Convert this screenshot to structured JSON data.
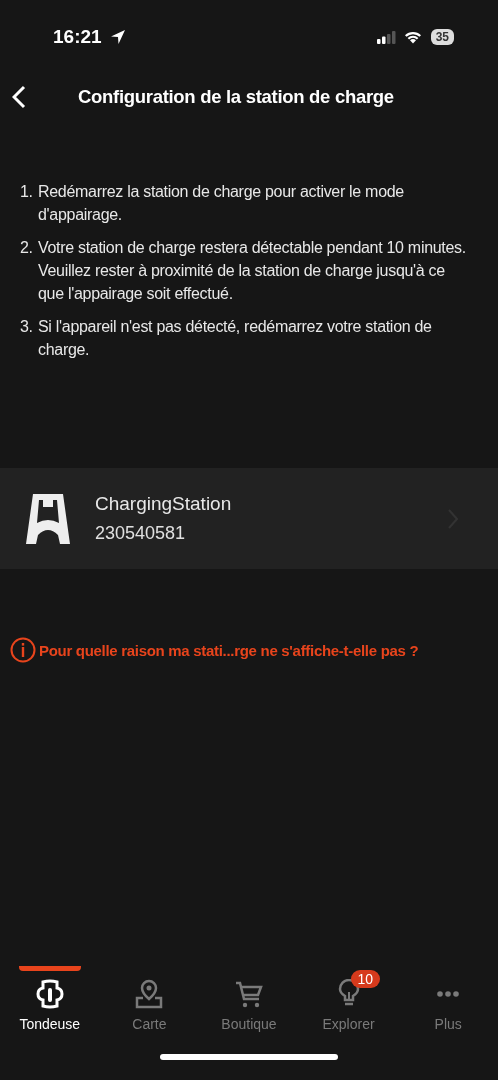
{
  "status_bar": {
    "time": "16:21",
    "battery": "35"
  },
  "header": {
    "title": "Configuration de la station de charge"
  },
  "instructions": [
    {
      "number": "1.",
      "text": "Redémarrez la station de charge pour activer le mode d'appairage."
    },
    {
      "number": "2.",
      "text": "Votre station de charge restera détectable pendant 10  minutes. Veuillez rester à proximité de la station de charge jusqu'à ce que l'appairage soit effectué."
    },
    {
      "number": "3.",
      "text": "Si l'appareil n'est pas détecté, redémarrez votre station de charge."
    }
  ],
  "devices": [
    {
      "name": "ChargingStation",
      "serial": "230540581"
    }
  ],
  "help_link": "Pour quelle raison ma stati...rge ne s'affiche-t-elle pas  ?",
  "tabs": [
    {
      "label": "Tondeuse",
      "kind": "mower",
      "selected": true
    },
    {
      "label": "Carte",
      "kind": "map",
      "selected": false
    },
    {
      "label": "Boutique",
      "kind": "cart",
      "selected": false
    },
    {
      "label": "Explorer",
      "kind": "bulb",
      "selected": false,
      "badge": "10"
    },
    {
      "label": "Plus",
      "kind": "more",
      "selected": false
    }
  ]
}
